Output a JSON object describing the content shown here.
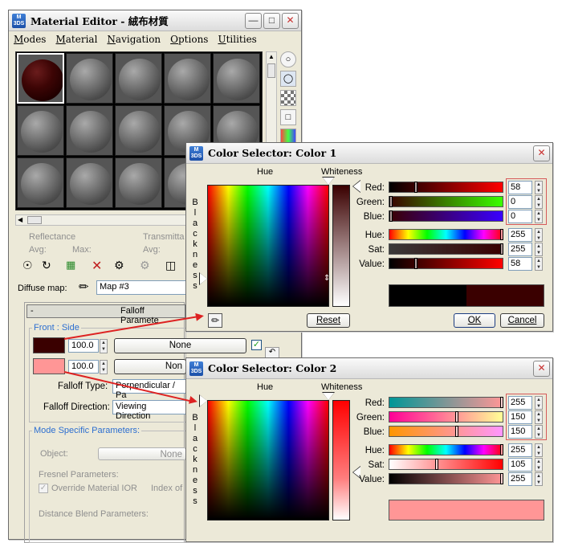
{
  "material_editor": {
    "title": "Material Editor - 絨布材質",
    "menu": [
      "Modes",
      "Material",
      "Navigation",
      "Options",
      "Utilities"
    ],
    "params": {
      "reflectance": "Reflectance",
      "avg": "Avg:",
      "max": "Max:",
      "transmittance": "Transmitta",
      "avg2": "Avg:"
    },
    "diffuse_map_label": "Diffuse map:",
    "diffuse_map_value": "Map #3",
    "falloff_header_dash": "-",
    "falloff_header": "Falloff Paramete",
    "front_side": "Front : Side",
    "row1_amount": "100.0",
    "row1_map": "None",
    "row2_amount": "100.0",
    "row2_map": "Non",
    "falloff_type_label": "Falloff Type:",
    "falloff_type_value": "Perpendicular / Pa",
    "falloff_direction_label": "Falloff Direction:",
    "falloff_direction_value": "Viewing Direction",
    "mode_specific": "Mode Specific Parameters:",
    "object_label": "Object:",
    "object_value": "None",
    "fresnel": "Fresnel Parameters:",
    "override_ior": "Override Material IOR",
    "index_of": "Index of",
    "distance_blend": "Distance Blend Parameters:"
  },
  "color1": {
    "title": "Color Selector: Color 1",
    "hue_label": "Hue",
    "whiteness_label": "Whiteness",
    "blackness_letters": [
      "B",
      "l",
      "a",
      "c",
      "k",
      "n",
      "e",
      "s",
      "s"
    ],
    "reset": "Reset",
    "ok": "OK",
    "cancel": "Cancel",
    "red_label": "Red:",
    "green_label": "Green:",
    "blue_label": "Blue:",
    "hue2_label": "Hue:",
    "sat_label": "Sat:",
    "value_label": "Value:",
    "red": "58",
    "green": "0",
    "blue": "0",
    "hue": "255",
    "sat": "255",
    "value": "58",
    "swatch_old": "#000000",
    "swatch_new": "#3a0000"
  },
  "color2": {
    "title": "Color Selector: Color 2",
    "hue_label": "Hue",
    "whiteness_label": "Whiteness",
    "blackness_letters": [
      "B",
      "l",
      "a",
      "c",
      "k",
      "n",
      "e",
      "s",
      "s"
    ],
    "red_label": "Red:",
    "green_label": "Green:",
    "blue_label": "Blue:",
    "hue2_label": "Hue:",
    "sat_label": "Sat:",
    "value_label": "Value:",
    "red": "255",
    "green": "150",
    "blue": "150",
    "hue": "255",
    "sat": "105",
    "value": "255",
    "swatch_new": "#ff9696"
  },
  "colors": {
    "swatch1": "#3a0000",
    "swatch2": "#ff9696",
    "accent": "#2c6ed0",
    "arrow": "#dd2222"
  }
}
